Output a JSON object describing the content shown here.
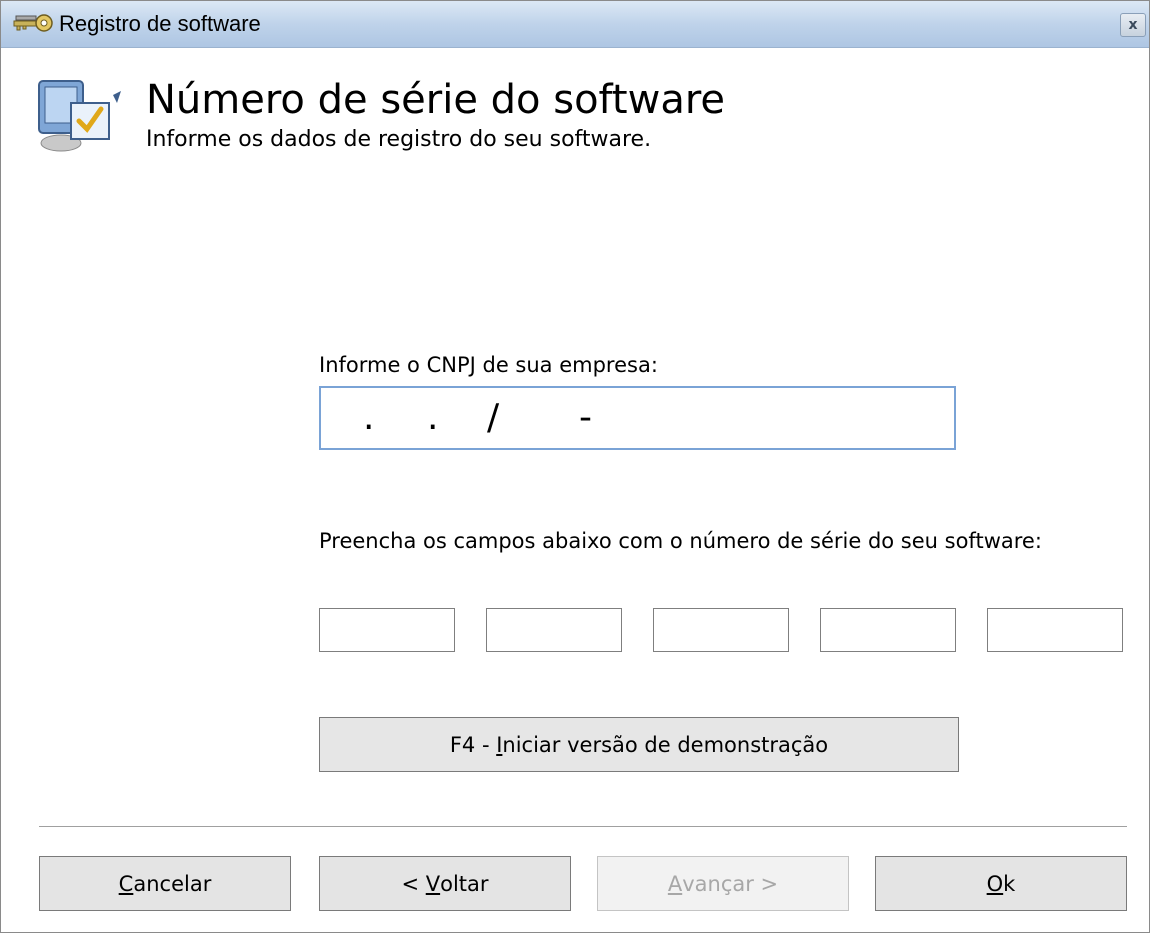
{
  "window": {
    "title": "Registro de software",
    "close_glyph": "x",
    "title_icon": "keys-icon"
  },
  "header": {
    "title": "Número de série do software",
    "subtitle": "Informe os dados de registro do seu software.",
    "icon": "computer-checkmark-icon"
  },
  "cnpj": {
    "label": "Informe o CNPJ de sua empresa:",
    "mask": {
      "dot1": ".",
      "dot2": ".",
      "slash": "/",
      "dash": "-"
    },
    "value": ""
  },
  "serial": {
    "label": "Preencha os campos abaixo com o número de série do seu software:",
    "fields": [
      "",
      "",
      "",
      "",
      ""
    ]
  },
  "buttons": {
    "demo": {
      "prefix": "F4 - ",
      "accel": "I",
      "rest": "niciar versão de demonstração"
    },
    "cancel": {
      "accel": "C",
      "rest": "ancelar"
    },
    "back": {
      "prefix": "< ",
      "accel": "V",
      "rest": "oltar"
    },
    "next": {
      "accel": "A",
      "rest": "vançar >",
      "enabled": false
    },
    "ok": {
      "accel": "O",
      "rest": "k"
    }
  }
}
